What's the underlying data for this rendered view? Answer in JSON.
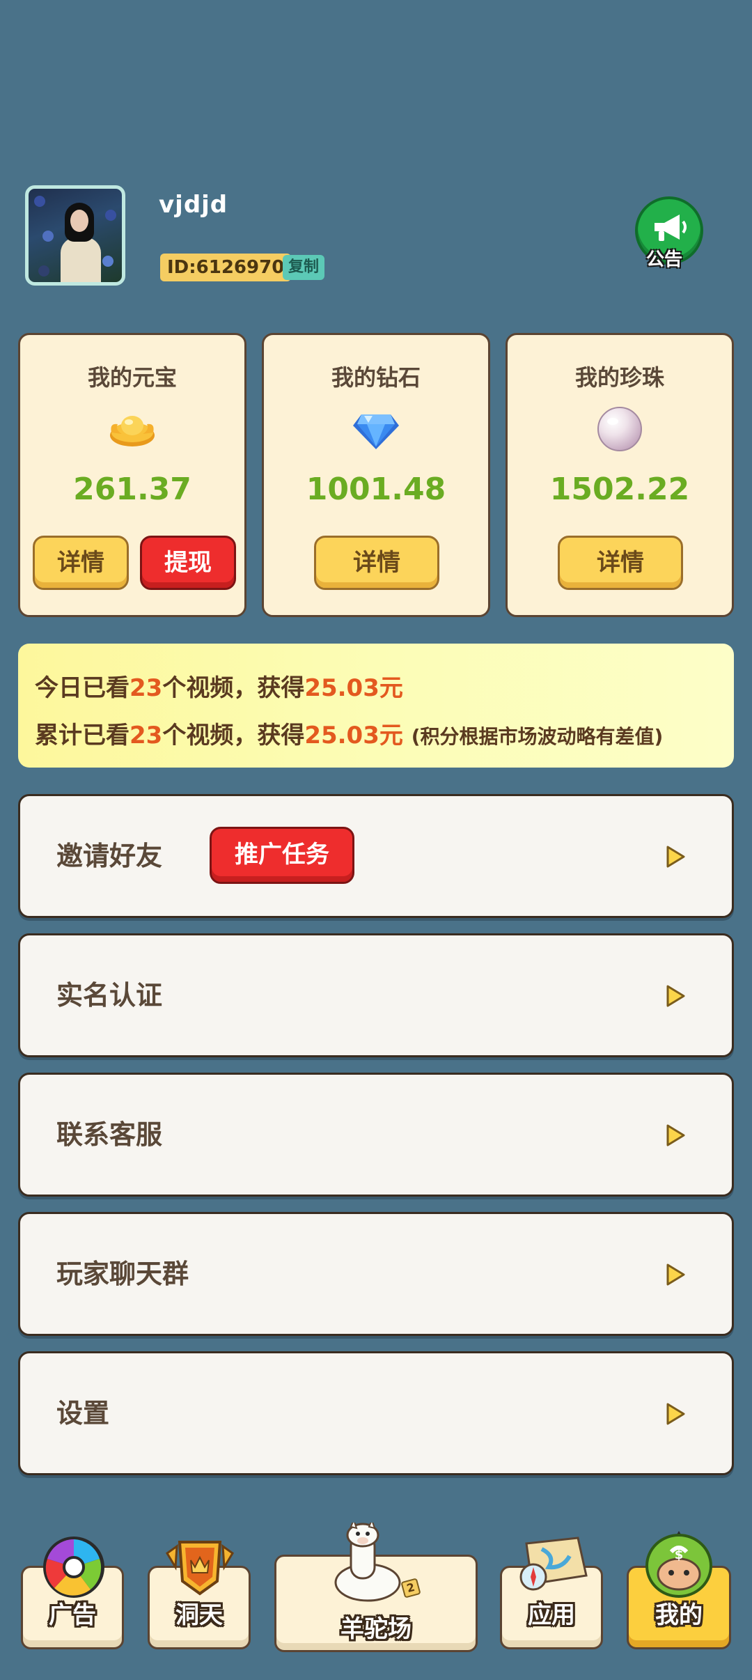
{
  "profile": {
    "username": "vjdjd",
    "id_label": "ID:6126970",
    "copy_label": "复制",
    "notice_label": "公告"
  },
  "cards": [
    {
      "title": "我的元宝",
      "icon": "gold-ingot-icon",
      "value": "261.37",
      "buttons": [
        "详情",
        "提现"
      ]
    },
    {
      "title": "我的钻石",
      "icon": "diamond-icon",
      "value": "1001.48",
      "buttons": [
        "详情"
      ]
    },
    {
      "title": "我的珍珠",
      "icon": "pearl-icon",
      "value": "1502.22",
      "buttons": [
        "详情"
      ]
    }
  ],
  "stats": {
    "today_prefix": "今日已看",
    "today_count": "23",
    "today_mid": "个视频，获得",
    "today_amount": "25.03元",
    "total_prefix": "累计已看",
    "total_count": "23",
    "total_mid": "个视频，获得",
    "total_amount": "25.03元",
    "total_note": "(积分根据市场波动略有差值)"
  },
  "menu": [
    {
      "label": "邀请好友",
      "extra": "推广任务"
    },
    {
      "label": "实名认证"
    },
    {
      "label": "联系客服"
    },
    {
      "label": "玩家聊天群"
    },
    {
      "label": "设置"
    }
  ],
  "nav": {
    "ads": "广告",
    "cave": "洞天",
    "alpaca": "羊驼场",
    "alpaca_badge": "2",
    "apps": "应用",
    "mine": "我的"
  },
  "colors": {
    "background": "#4a7289",
    "card_bg": "#fdf2d6",
    "value_green": "#6aac22",
    "highlight_orange": "#e3591f",
    "button_yellow": "#fcd45a",
    "button_red": "#ee2d2d",
    "notice_green": "#22b04a"
  }
}
